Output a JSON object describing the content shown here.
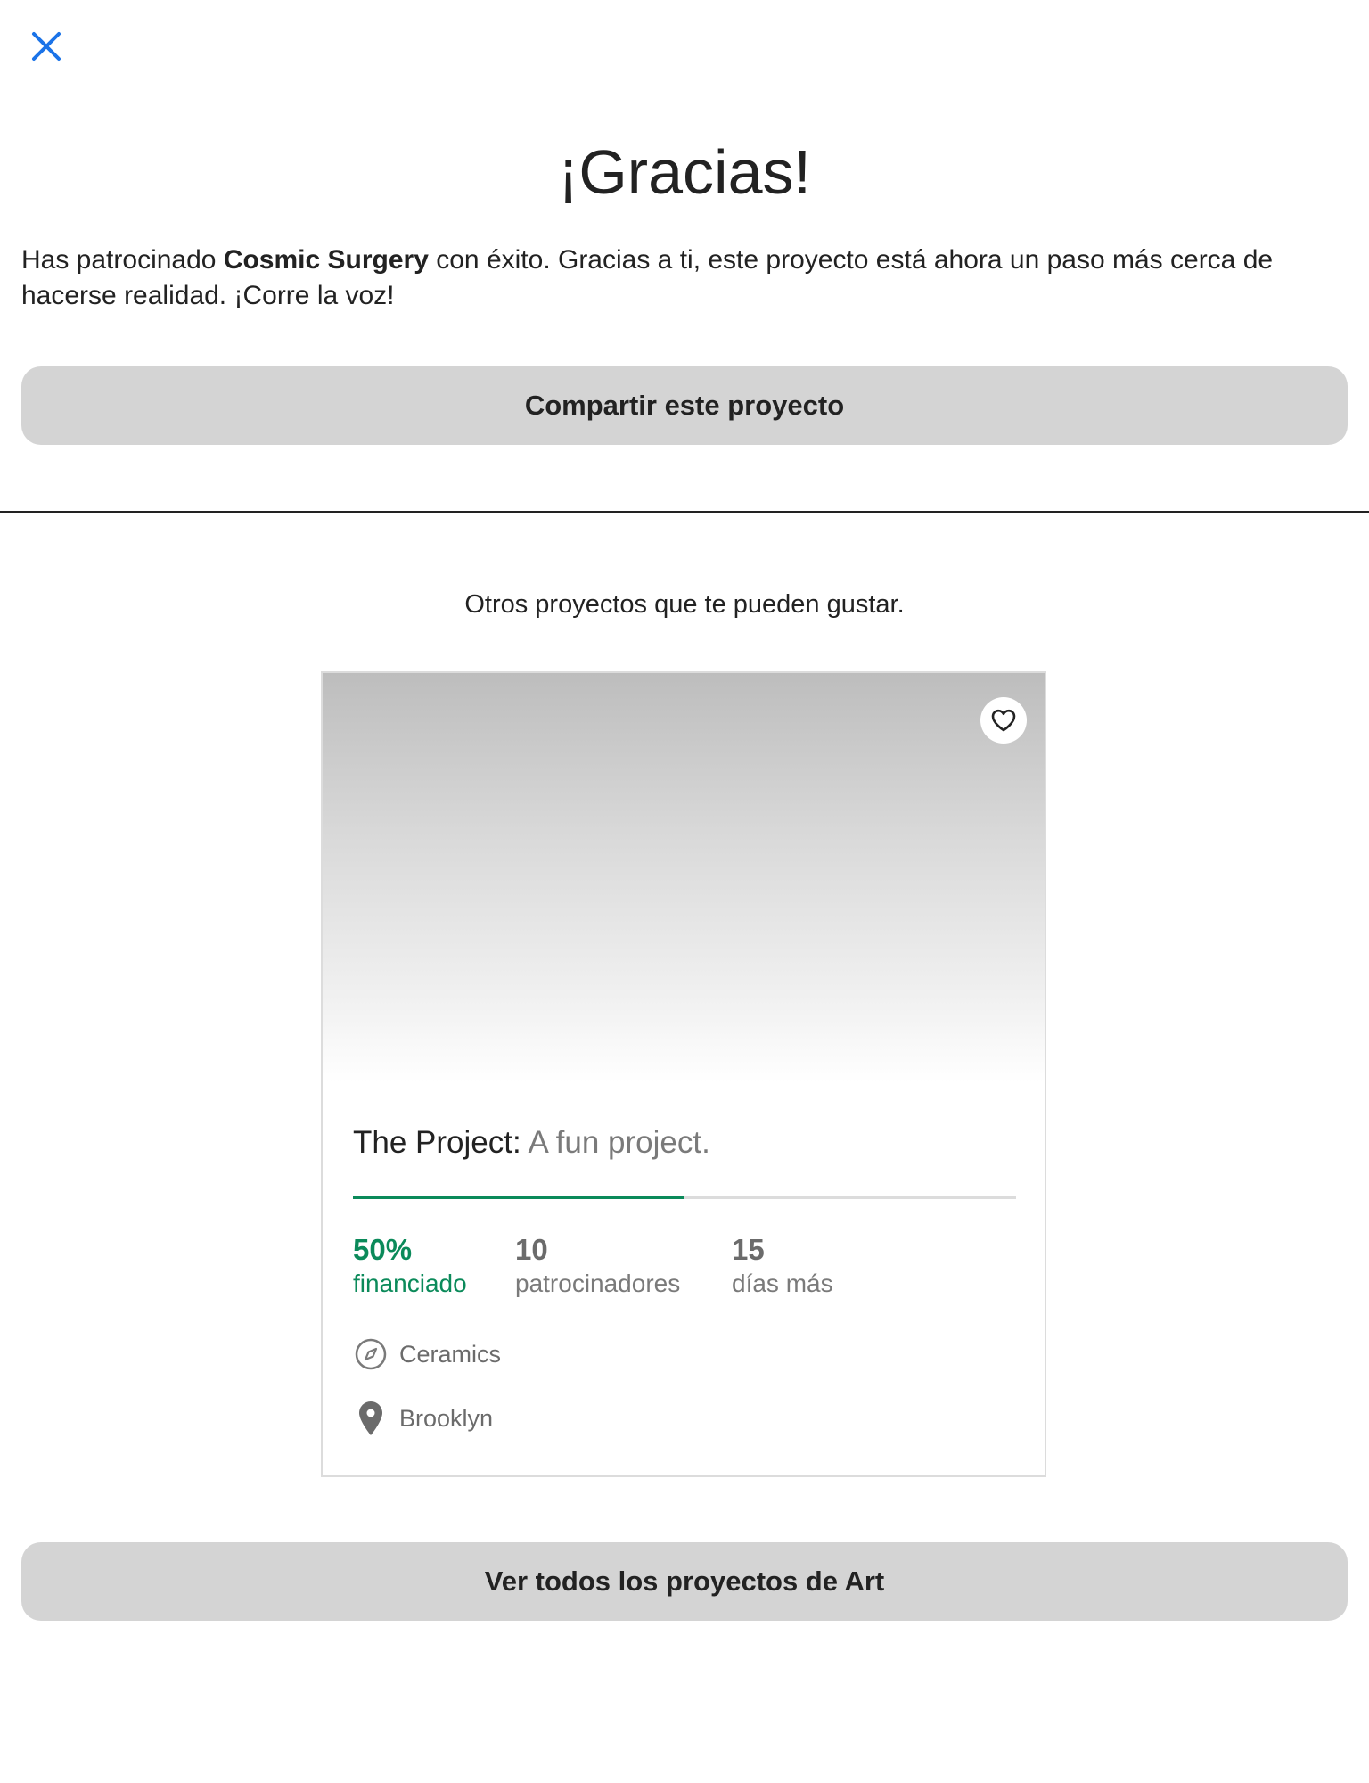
{
  "header": {
    "close_icon": "close-icon",
    "accent_color": "#1a73e8"
  },
  "thanks": {
    "title": "¡Gracias!",
    "message_prefix": "Has patrocinado ",
    "project_name": "Cosmic Surgery",
    "message_suffix": " con éxito. Gracias a ti, este proyecto está ahora un paso más cerca de hacerse realidad. ¡Corre la voz!",
    "share_button": "Compartir este proyecto"
  },
  "recommendations": {
    "heading": "Otros proyectos que te pueden gustar.",
    "card": {
      "name": "The Project:",
      "blurb": "A fun project.",
      "heart_icon": "heart-outline-icon",
      "funded_percent": 50,
      "funded_value": "50%",
      "funded_label": "financiado",
      "backers_value": "10",
      "backers_label": "patrocinadores",
      "days_value": "15",
      "days_label": "días más",
      "category": "Ceramics",
      "category_icon": "compass-icon",
      "location": "Brooklyn",
      "location_icon": "location-pin-icon",
      "funded_color": "#0b8a5a"
    },
    "view_all_button": "Ver todos los proyectos de Art"
  }
}
